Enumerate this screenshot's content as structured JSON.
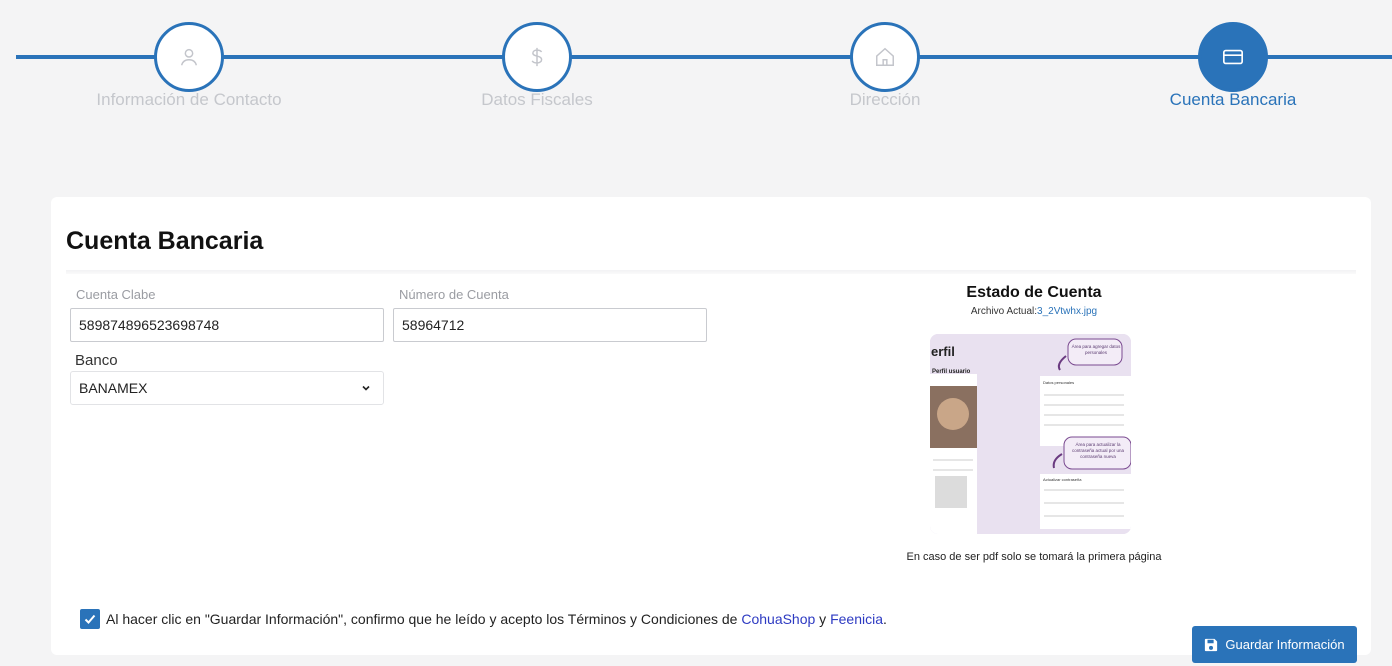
{
  "stepper": {
    "steps": [
      {
        "label": "Información de Contacto",
        "icon": "user-icon"
      },
      {
        "label": "Datos Fiscales",
        "icon": "dollar-icon"
      },
      {
        "label": "Dirección",
        "icon": "home-icon"
      },
      {
        "label": "Cuenta Bancaria",
        "icon": "credit-card-icon"
      }
    ],
    "active_index": 3,
    "accent": "#2a73b9",
    "inactive_label_color": "#c5c7cc"
  },
  "card": {
    "title": "Cuenta Bancaria",
    "clabe": {
      "label": "Cuenta Clabe",
      "value": "589874896523698748"
    },
    "account": {
      "label": "Número de Cuenta",
      "value": "58964712"
    },
    "bank": {
      "label": "Banco",
      "value": "BANAMEX"
    },
    "statement": {
      "title": "Estado de Cuenta",
      "file_prefix": "Archivo Actual:",
      "file_name": "3_2Vtwhx.jpg",
      "note": "En caso de ser pdf solo se tomará la primera página",
      "preview_texts": {
        "heading": "erfil",
        "subheading": "Perfil usuario",
        "bubble1": "Área para agregar datos personales",
        "bubble2": "Área para actualizar la contraseña actual por una contraseña nueva",
        "section1": "Datos personales",
        "section2": "Actualizar contraseña"
      }
    },
    "terms": {
      "prefix": "Al hacer clic en \"Guardar Información\", confirmo que he leído y acepto los Términos y Condiciones de ",
      "link1": "CohuaShop",
      "join": " y ",
      "link2": "Feenicia",
      "suffix": ".",
      "checked": true
    }
  },
  "save_button": {
    "label": "Guardar Información",
    "icon": "save-icon"
  }
}
